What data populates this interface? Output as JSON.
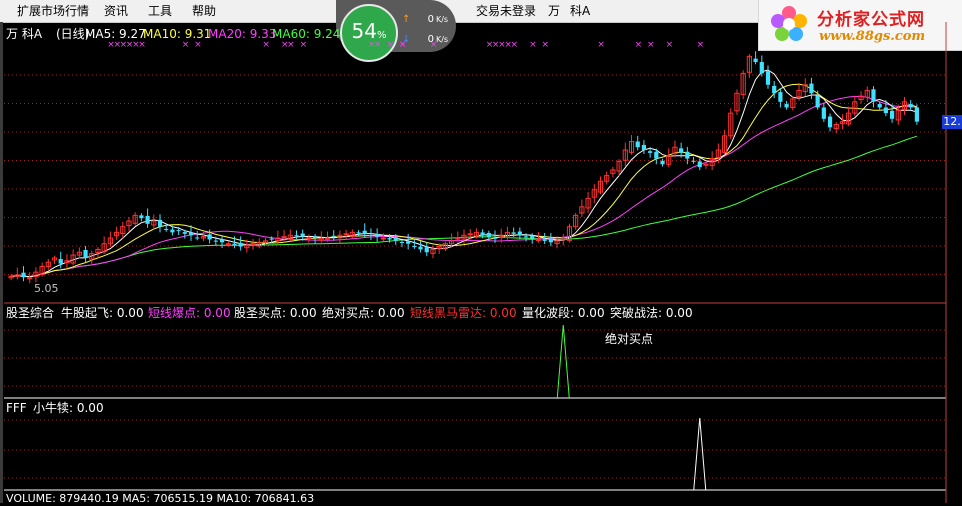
{
  "menubar": {
    "items": [
      "扩展市场行情",
      "资讯",
      "工具",
      "帮助"
    ],
    "status": "交易未登录",
    "right_items": [
      "万",
      "科A"
    ]
  },
  "net_widget": {
    "percent": "54",
    "percent_sign": "%",
    "upload": "0",
    "download": "0",
    "unit": "K/s"
  },
  "logo": {
    "text": "分析家公式网",
    "url": "www.88gs.com"
  },
  "main_panel": {
    "stock": "万  科A",
    "period": "(日线)",
    "ma5": "MA5: 9.27",
    "ma10": "MA10: 9.31",
    "ma20": "MA20: 9.33",
    "ma60": "MA60: 9.24",
    "low_label": "5.05",
    "price_badge": "12."
  },
  "indicator1": {
    "name": "股圣综合",
    "items": [
      {
        "label": "牛股起飞: 0.00",
        "color": "#ffffff"
      },
      {
        "label": "短线爆点: 0.00",
        "color": "#ff40ff"
      },
      {
        "label": "股圣买点: 0.00",
        "color": "#ffffff"
      },
      {
        "label": "绝对买点: 0.00",
        "color": "#ffffff"
      },
      {
        "label": "短线黑马雷达: 0.00",
        "color": "#ff3030"
      },
      {
        "label": "量化波段: 0.00",
        "color": "#ffffff"
      },
      {
        "label": "突破战法: 0.00",
        "color": "#ffffff"
      }
    ],
    "annotation": "绝对买点",
    "spike_bar": 89
  },
  "indicator2": {
    "name": "FFF",
    "item": "小牛犊: 0.00",
    "spike_bar": 111
  },
  "volume_row": {
    "text": "VOLUME: 879440.19  MA5: 706515.19  MA10: 706841.63"
  },
  "colors": {
    "up": "#ff3030",
    "down": "#40e0ff",
    "ma5": "#ffffff",
    "ma10": "#ffff40",
    "ma20": "#ff40ff",
    "ma60": "#40ff40",
    "grid": "#a02020",
    "marker": "#ff40ff"
  },
  "chart_data": {
    "type": "candlestick",
    "title": "万 科A (日线)",
    "ylim": [
      4.5,
      13.2
    ],
    "closes": [
      5.05,
      5.1,
      5.02,
      5.0,
      5.2,
      5.4,
      5.55,
      5.7,
      5.5,
      5.6,
      5.8,
      5.9,
      5.7,
      5.85,
      6.0,
      6.2,
      6.4,
      6.6,
      6.8,
      7.0,
      7.2,
      7.1,
      6.9,
      7.0,
      6.8,
      6.7,
      6.6,
      6.65,
      6.55,
      6.5,
      6.4,
      6.45,
      6.35,
      6.3,
      6.25,
      6.2,
      6.15,
      6.1,
      6.15,
      6.2,
      6.25,
      6.3,
      6.35,
      6.4,
      6.45,
      6.5,
      6.48,
      6.45,
      6.42,
      6.4,
      6.38,
      6.4,
      6.45,
      6.5,
      6.55,
      6.6,
      6.58,
      6.55,
      6.5,
      6.45,
      6.4,
      6.35,
      6.3,
      6.25,
      6.2,
      6.1,
      6.0,
      5.9,
      6.0,
      6.1,
      6.2,
      6.3,
      6.4,
      6.5,
      6.55,
      6.6,
      6.5,
      6.45,
      6.4,
      6.5,
      6.6,
      6.55,
      6.5,
      6.45,
      6.4,
      6.35,
      6.3,
      6.25,
      6.3,
      6.4,
      6.8,
      7.2,
      7.5,
      7.8,
      8.1,
      8.4,
      8.6,
      8.8,
      9.1,
      9.5,
      9.8,
      9.6,
      9.5,
      9.4,
      9.2,
      9.0,
      9.3,
      9.6,
      9.4,
      9.2,
      9.1,
      8.9,
      9.0,
      9.2,
      9.5,
      10.0,
      10.8,
      11.5,
      12.2,
      12.8,
      12.6,
      12.2,
      11.8,
      11.5,
      11.2,
      11.0,
      11.3,
      11.6,
      11.8,
      11.5,
      11.0,
      10.6,
      10.3,
      10.4,
      10.5,
      10.8,
      11.2,
      11.4,
      11.6,
      11.2,
      11.0,
      10.8,
      10.6,
      10.9,
      11.2,
      11.0,
      10.5
    ]
  }
}
